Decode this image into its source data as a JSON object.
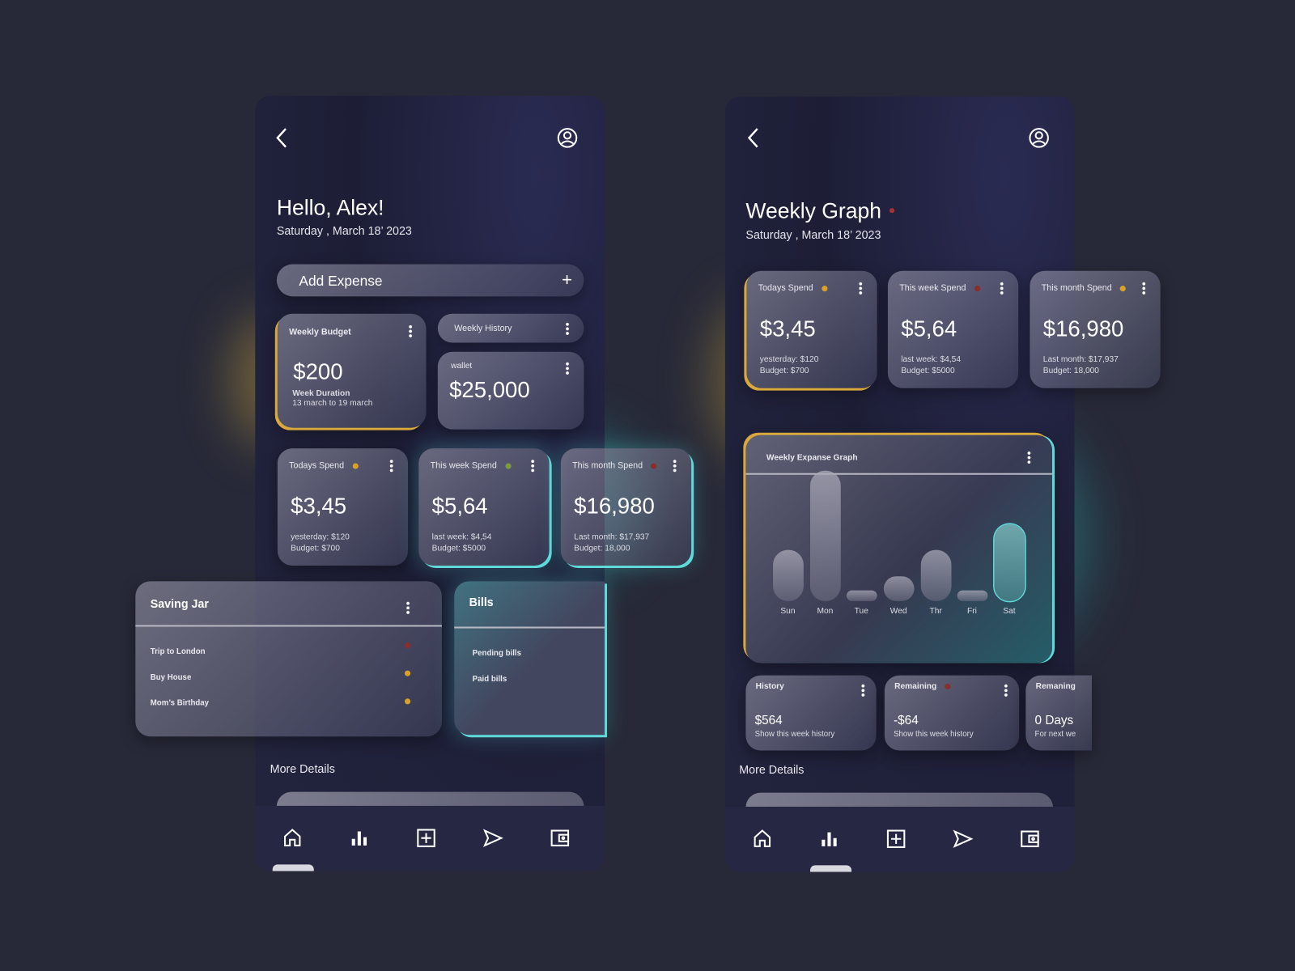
{
  "left": {
    "greeting": "Hello, Alex!",
    "date": "Saturday , March 18’ 2023",
    "add_expense": "Add Expense",
    "weekly_budget": {
      "title": "Weekly Budget",
      "amount": "$200",
      "duration_label": "Week Duration",
      "duration": "13 march to 19 march"
    },
    "weekly_history": "Weekly History",
    "wallet": {
      "title": "wallet",
      "amount": "$25,000"
    },
    "spend_cards": [
      {
        "title": "Todays Spend",
        "dot": "#d9a128",
        "amount": "$3,45",
        "line1": "yesterday: $120",
        "line2": "Budget: $700"
      },
      {
        "title": "This week Spend",
        "dot": "#7f9b3f",
        "amount": "$5,64",
        "line1": "last week: $4,54",
        "line2": "Budget: $5000"
      },
      {
        "title": "This month Spend",
        "dot": "#8c2d2d",
        "amount": "$16,980",
        "line1": "Last month: $17,937",
        "line2": "Budget: 18,000"
      }
    ],
    "saving_jar": {
      "title": "Saving Jar",
      "items": [
        {
          "label": "Trip to London",
          "dot": "#8c2d2d"
        },
        {
          "label": "Buy House",
          "dot": "#d9a128"
        },
        {
          "label": "Mom’s Birthday",
          "dot": "#d9a128"
        }
      ]
    },
    "bills": {
      "title": "Bills",
      "items": [
        "Pending bills",
        "Paid bills"
      ]
    },
    "more_details": "More Details"
  },
  "right": {
    "title": "Weekly Graph",
    "title_dot": "#a83232",
    "date": "Saturday , March 18’ 2023",
    "spend_cards": [
      {
        "title": "Todays Spend",
        "dot": "#d9a128",
        "amount": "$3,45",
        "line1": "yesterday: $120",
        "line2": "Budget: $700"
      },
      {
        "title": "This week Spend",
        "dot": "#8c2d2d",
        "amount": "$5,64",
        "line1": "last week: $4,54",
        "line2": "Budget: $5000"
      },
      {
        "title": "This month Spend",
        "dot": "#d9a128",
        "amount": "$16,980",
        "line1": "Last month: $17,937",
        "line2": "Budget: 18,000"
      }
    ],
    "graph_title": "Weekly Expanse Graph",
    "bottom_cards": [
      {
        "title": "History",
        "amount": "$564",
        "sub": "Show this week history"
      },
      {
        "title": "Remaining",
        "dot": "#8c2d2d",
        "amount": "-$64",
        "sub": "Show this week history"
      },
      {
        "title": "Remaning",
        "amount": "0 Days",
        "sub": "For next we"
      }
    ],
    "more_details": "More Details"
  },
  "nav_icons": [
    "home-icon",
    "bar-chart-icon",
    "add-square-icon",
    "send-icon",
    "wallet-icon"
  ],
  "colors": {
    "gold": "#d9a93c",
    "teal": "#5fd8d8",
    "background": "#272938"
  },
  "chart_data": {
    "type": "bar",
    "title": "Weekly Expanse Graph",
    "categories": [
      "Sun",
      "Mon",
      "Tue",
      "Wed",
      "Thr",
      "Fri",
      "Sat"
    ],
    "values": [
      39,
      100,
      8,
      19,
      39,
      8,
      59
    ],
    "highlight": "Sat",
    "grid": false
  }
}
